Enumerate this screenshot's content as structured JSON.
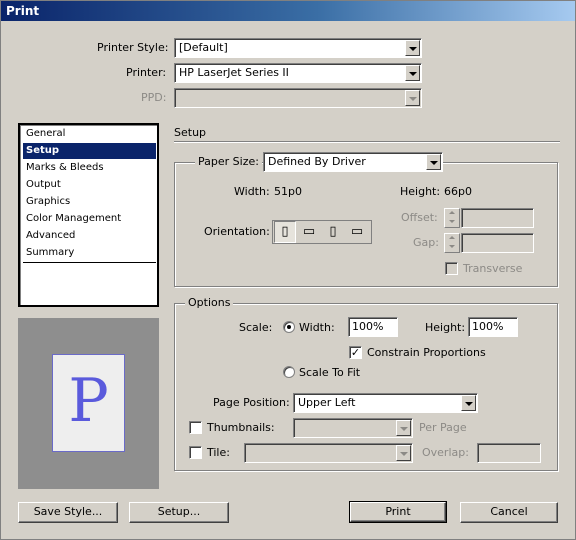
{
  "window": {
    "title": "Print"
  },
  "top": {
    "printer_style": {
      "label": "Printer Style:",
      "value": "[Default]"
    },
    "printer": {
      "label": "Printer:",
      "value": "HP LaserJet Series II"
    },
    "ppd": {
      "label": "PPD:",
      "value": ""
    }
  },
  "sidebar": {
    "items": [
      {
        "label": "General"
      },
      {
        "label": "Setup"
      },
      {
        "label": "Marks & Bleeds"
      },
      {
        "label": "Output"
      },
      {
        "label": "Graphics"
      },
      {
        "label": "Color Management"
      },
      {
        "label": "Advanced"
      },
      {
        "label": "Summary"
      }
    ],
    "selected": "Setup"
  },
  "preview": {
    "letter": "P"
  },
  "setup": {
    "heading": "Setup",
    "paper_size": {
      "label": "Paper Size:",
      "value": "Defined By Driver"
    },
    "width": {
      "label": "Width:",
      "value": "51p0"
    },
    "height": {
      "label": "Height:",
      "value": "66p0"
    },
    "orientation": {
      "label": "Orientation:",
      "icons": [
        "portrait-icon",
        "landscape-icon",
        "reverse-portrait-icon",
        "reverse-landscape-icon"
      ]
    },
    "offset": {
      "label": "Offset:",
      "value": ""
    },
    "gap": {
      "label": "Gap:",
      "value": ""
    },
    "transverse": {
      "label": "Transverse",
      "checked": false
    }
  },
  "options": {
    "title": "Options",
    "scale_label": "Scale:",
    "scale_width": {
      "label": "Width:",
      "value": "100%",
      "selected": true
    },
    "scale_height": {
      "label": "Height:",
      "value": "100%"
    },
    "constrain": {
      "label": "Constrain Proportions",
      "checked": true
    },
    "scale_to_fit": {
      "label": "Scale To Fit",
      "selected": false
    },
    "page_position": {
      "label": "Page Position:",
      "value": "Upper Left"
    },
    "thumbnails": {
      "label": "Thumbnails:",
      "value": "",
      "suffix": "Per Page",
      "checked": false
    },
    "tile": {
      "label": "Tile:",
      "value": "",
      "overlap_label": "Overlap:",
      "overlap_value": "",
      "checked": false
    }
  },
  "buttons": {
    "save_style": "Save Style...",
    "setup": "Setup...",
    "print": "Print",
    "cancel": "Cancel"
  }
}
